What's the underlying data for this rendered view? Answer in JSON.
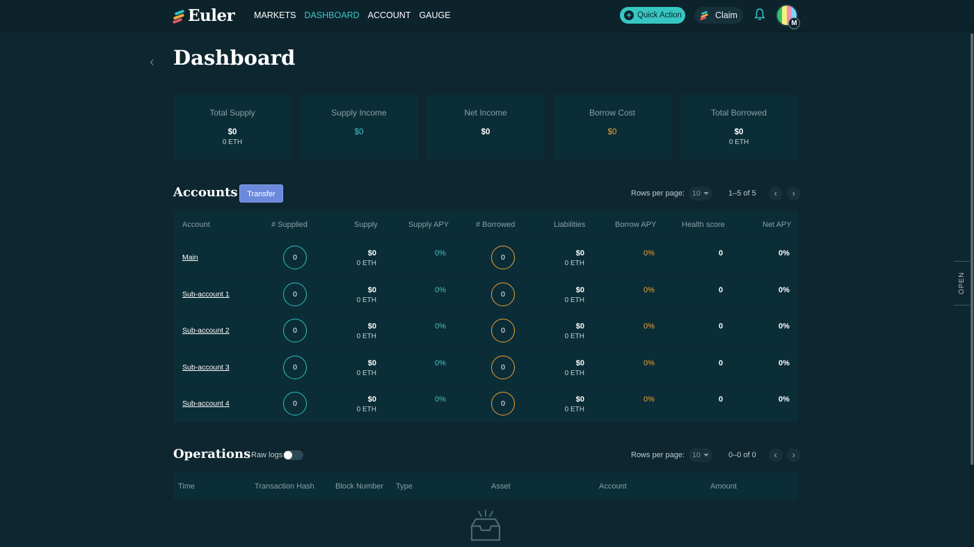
{
  "app": {
    "logo_text": "Euler",
    "nav": [
      "MARKETS",
      "DASHBOARD",
      "ACCOUNT",
      "GAUGE"
    ],
    "active_nav": "DASHBOARD",
    "quick_action": "Quick Action",
    "claim": "Claim",
    "avatar_initial": "M",
    "side_tab": "OPEN"
  },
  "page": {
    "title": "Dashboard"
  },
  "stats": [
    {
      "label": "Total Supply",
      "value": "$0",
      "sub": "0 ETH"
    },
    {
      "label": "Supply Income",
      "value": "$0",
      "sub": ""
    },
    {
      "label": "Net Income",
      "value": "$0",
      "sub": ""
    },
    {
      "label": "Borrow Cost",
      "value": "$0",
      "sub": ""
    },
    {
      "label": "Total Borrowed",
      "value": "$0",
      "sub": "0 ETH"
    }
  ],
  "accounts": {
    "title": "Accounts",
    "transfer": "Transfer",
    "rows_per_page_label": "Rows per page:",
    "rows_per_page": "10",
    "range": "1–5 of 5",
    "columns": [
      "Account",
      "# Supplied",
      "Supply",
      "Supply APY",
      "# Borrowed",
      "Liabilities",
      "Borrow APY",
      "Health score",
      "Net APY"
    ],
    "rows": [
      {
        "account": "Main",
        "supplied": "0",
        "supply": "$0",
        "supply_eth": "0 ETH",
        "supply_apy": "0%",
        "borrowed": "0",
        "liabilities": "$0",
        "liabilities_eth": "0 ETH",
        "borrow_apy": "0%",
        "health": "0",
        "net_apy": "0%"
      },
      {
        "account": "Sub-account 1",
        "supplied": "0",
        "supply": "$0",
        "supply_eth": "0 ETH",
        "supply_apy": "0%",
        "borrowed": "0",
        "liabilities": "$0",
        "liabilities_eth": "0 ETH",
        "borrow_apy": "0%",
        "health": "0",
        "net_apy": "0%"
      },
      {
        "account": "Sub-account 2",
        "supplied": "0",
        "supply": "$0",
        "supply_eth": "0 ETH",
        "supply_apy": "0%",
        "borrowed": "0",
        "liabilities": "$0",
        "liabilities_eth": "0 ETH",
        "borrow_apy": "0%",
        "health": "0",
        "net_apy": "0%"
      },
      {
        "account": "Sub-account 3",
        "supplied": "0",
        "supply": "$0",
        "supply_eth": "0 ETH",
        "supply_apy": "0%",
        "borrowed": "0",
        "liabilities": "$0",
        "liabilities_eth": "0 ETH",
        "borrow_apy": "0%",
        "health": "0",
        "net_apy": "0%"
      },
      {
        "account": "Sub-account 4",
        "supplied": "0",
        "supply": "$0",
        "supply_eth": "0 ETH",
        "supply_apy": "0%",
        "borrowed": "0",
        "liabilities": "$0",
        "liabilities_eth": "0 ETH",
        "borrow_apy": "0%",
        "health": "0",
        "net_apy": "0%"
      }
    ]
  },
  "operations": {
    "title": "Operations",
    "raw_logs_label": "Raw logs:",
    "raw_logs_on": false,
    "rows_per_page_label": "Rows per page:",
    "rows_per_page": "10",
    "range": "0–0 of 0",
    "columns": [
      "Time",
      "Transaction Hash",
      "Block Number",
      "Type",
      "Asset",
      "Account",
      "Amount"
    ]
  },
  "colors": {
    "accent_teal": "#3cc6c4",
    "accent_orange": "#f0a33a",
    "transfer_blue": "#6c89dd",
    "background": "#0e2630"
  }
}
